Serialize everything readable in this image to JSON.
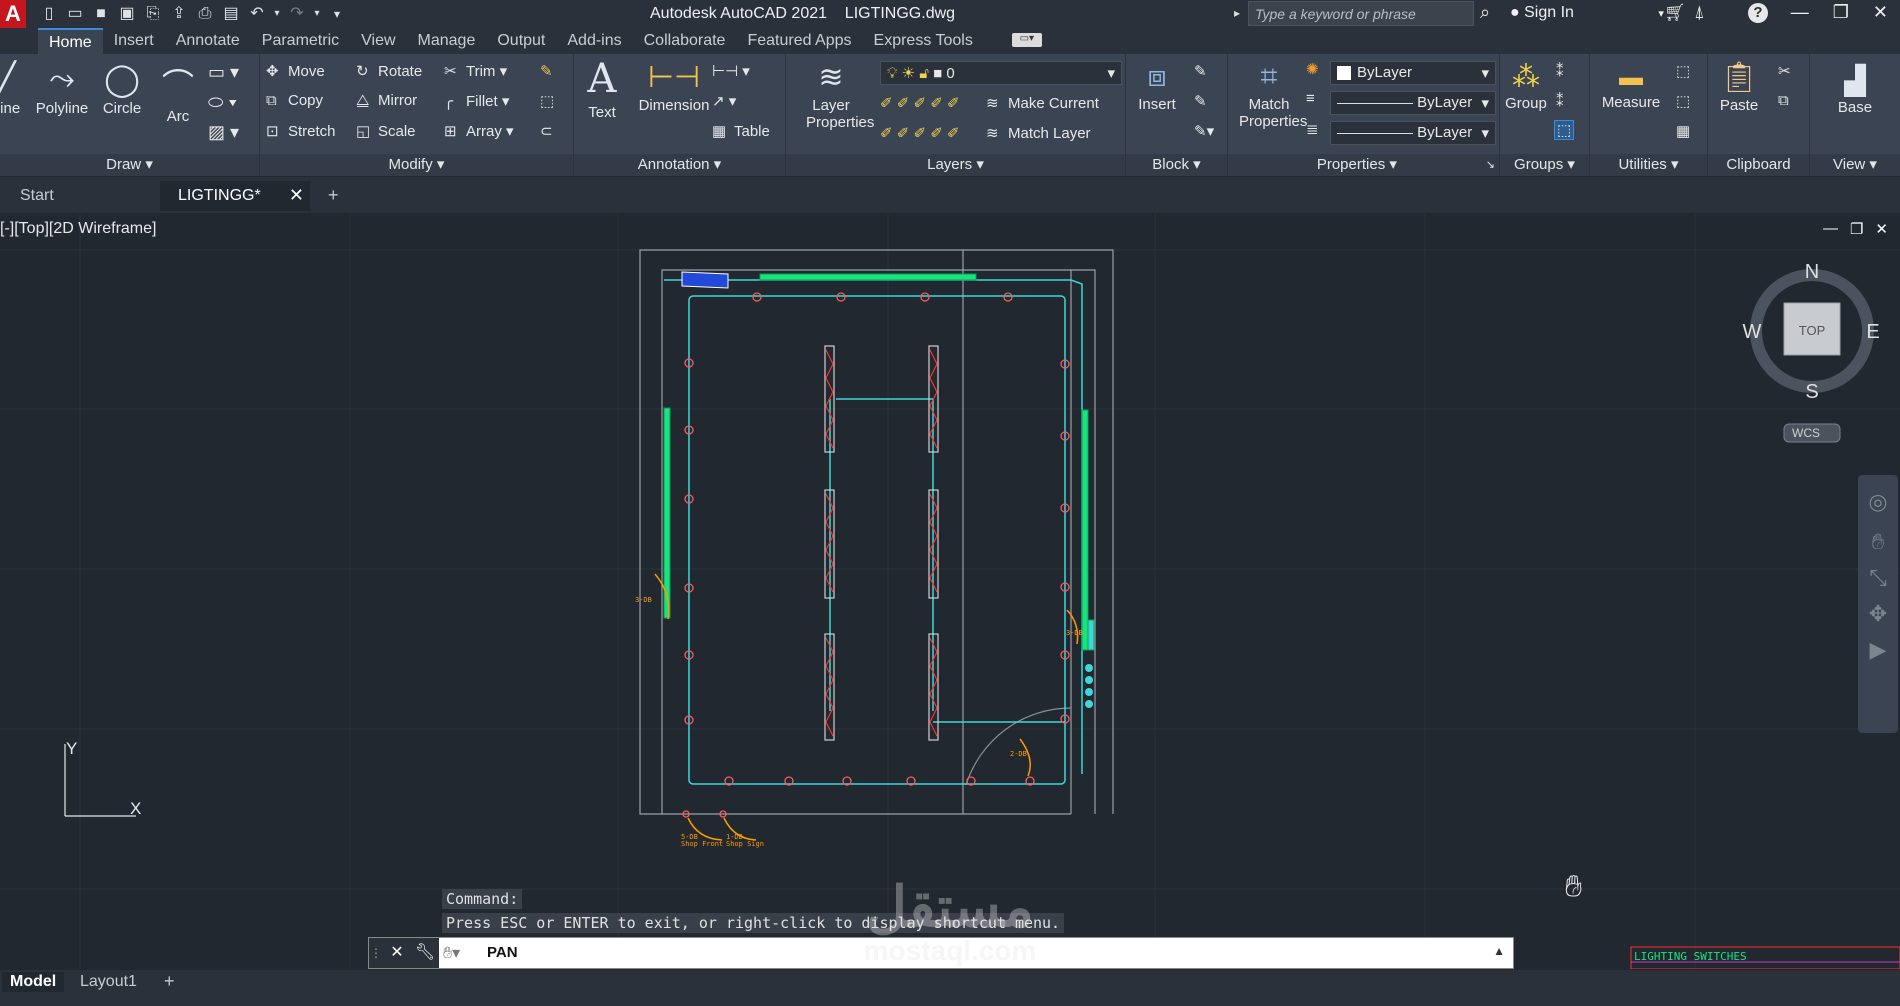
{
  "title_bar": {
    "app_title": "Autodesk AutoCAD 2021",
    "file_name": "LIGTINGG.dwg",
    "search_placeholder": "Type a keyword or phrase",
    "sign_in": "Sign In"
  },
  "ribbon_tabs": [
    "Home",
    "Insert",
    "Annotate",
    "Parametric",
    "View",
    "Manage",
    "Output",
    "Add-ins",
    "Collaborate",
    "Featured Apps",
    "Express Tools"
  ],
  "ribbon": {
    "draw": {
      "title": "Draw",
      "line": "Line",
      "polyline": "Polyline",
      "circle": "Circle",
      "arc": "Arc"
    },
    "modify": {
      "title": "Modify",
      "move": "Move",
      "rotate": "Rotate",
      "trim": "Trim",
      "copy": "Copy",
      "mirror": "Mirror",
      "fillet": "Fillet",
      "stretch": "Stretch",
      "scale": "Scale",
      "array": "Array"
    },
    "annotation": {
      "title": "Annotation",
      "text": "Text",
      "dimension": "Dimension",
      "table": "Table"
    },
    "layers": {
      "title": "Layers",
      "layer_properties": "Layer Properties",
      "current_layer": "0",
      "make_current": "Make Current",
      "match_layer": "Match Layer"
    },
    "block": {
      "title": "Block",
      "insert": "Insert"
    },
    "properties": {
      "title": "Properties",
      "match_properties": "Match Properties",
      "color": "ByLayer",
      "linetype": "ByLayer",
      "lineweight": "ByLayer"
    },
    "groups": {
      "title": "Groups",
      "group": "Group"
    },
    "utilities": {
      "title": "Utilities",
      "measure": "Measure"
    },
    "clipboard": {
      "title": "Clipboard",
      "paste": "Paste"
    },
    "view": {
      "title": "View",
      "base": "Base"
    }
  },
  "doc_tabs": {
    "start": "Start",
    "active": "LIGTINGG*"
  },
  "viewport": {
    "label": "[-][Top][2D Wireframe]",
    "viewcube": {
      "face": "TOP",
      "n": "N",
      "s": "S",
      "e": "E",
      "w": "W",
      "wcs": "WCS"
    },
    "ucs_y": "Y",
    "ucs_x": "X",
    "drawing_labels": {
      "circuit_left": "3-DB",
      "circuit_right": "3-DB",
      "circuit_bottom": "2-DB",
      "shop_front": "Shop Front",
      "shop_sign": "Shop Sign",
      "sf_code": "5-DB",
      "ss_code": "1-DB"
    },
    "legend_label": "LIGHTING SWITCHES"
  },
  "command": {
    "history_1": "Command:",
    "history_2": "Press ESC or ENTER to exit, or right-click to display shortcut menu.",
    "current": "PAN"
  },
  "layout_tabs": [
    "Model",
    "Layout1"
  ],
  "watermark": {
    "arabic": "مستقل",
    "latin": "mostaql.com"
  },
  "colors": {
    "accent": "#3c8ad8",
    "wire": "#3fd7d9",
    "fixture": "#ff3030",
    "panel": "#19e37e",
    "annot": "#ff9a00",
    "wall": "#9aa0a6"
  }
}
